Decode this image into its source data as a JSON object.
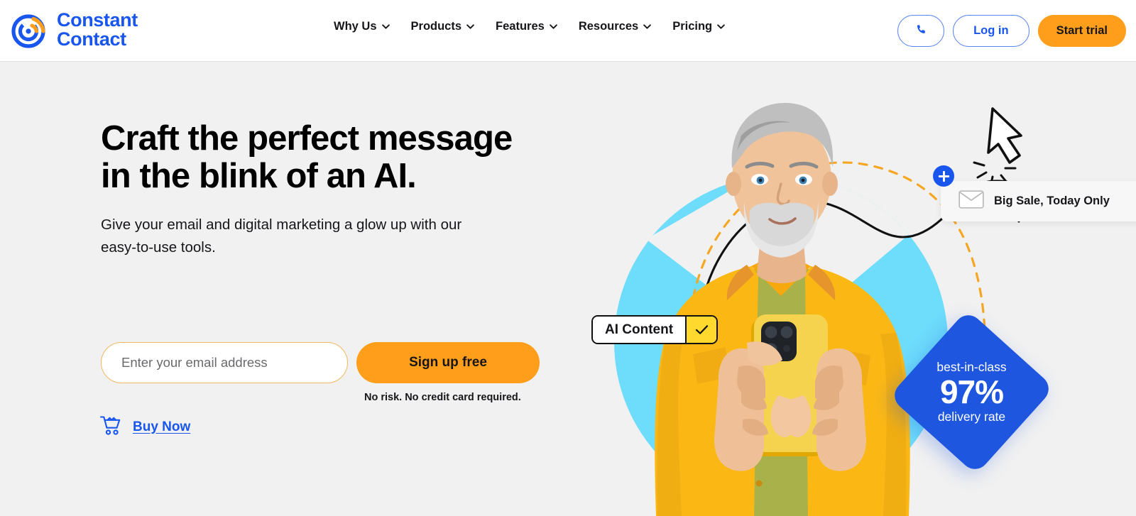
{
  "header": {
    "logo": {
      "icon": "constant-contact-logo-icon",
      "line1": "Constant",
      "line2": "Contact",
      "brand_blue": "#1856ED",
      "brand_orange": "#FF9E1B"
    },
    "nav": [
      {
        "label": "Why Us",
        "icon": "chevron-down-icon"
      },
      {
        "label": "Products",
        "icon": "chevron-down-icon"
      },
      {
        "label": "Features",
        "icon": "chevron-down-icon"
      },
      {
        "label": "Resources",
        "icon": "chevron-down-icon"
      },
      {
        "label": "Pricing",
        "icon": "chevron-down-icon"
      }
    ],
    "actions": {
      "phone_icon": "phone-icon",
      "login_label": "Log in",
      "trial_label": "Start trial"
    }
  },
  "hero": {
    "background_color": "#F1F1F1",
    "headline": "Craft the perfect message in the blink of an AI.",
    "subhead": "Give your email and digital marketing a glow up with our easy-to-use tools.",
    "form": {
      "email_placeholder": "Enter your email address",
      "email_value": "",
      "submit_label": "Sign up free",
      "note": "No risk. No credit card required."
    },
    "buy": {
      "icon": "shopping-cart-icon",
      "label": "Buy Now"
    },
    "art": {
      "circle_color": "#6EDCFB",
      "person_alt": "man-in-yellow-shirt-holding-phone",
      "cursor_icon": "mouse-cursor-click-icon",
      "badge_ai": {
        "label": "AI Content",
        "check_icon": "check-icon",
        "check_bg": "#FFD92E"
      },
      "notification": {
        "plus_icon": "plus-circle-icon",
        "envelope_icon": "envelope-icon",
        "text": "Big Sale, Today Only"
      },
      "badge_stat": {
        "top": "best-in-class",
        "value": "97%",
        "bottom": "delivery rate",
        "color": "#1E56E0"
      }
    }
  }
}
